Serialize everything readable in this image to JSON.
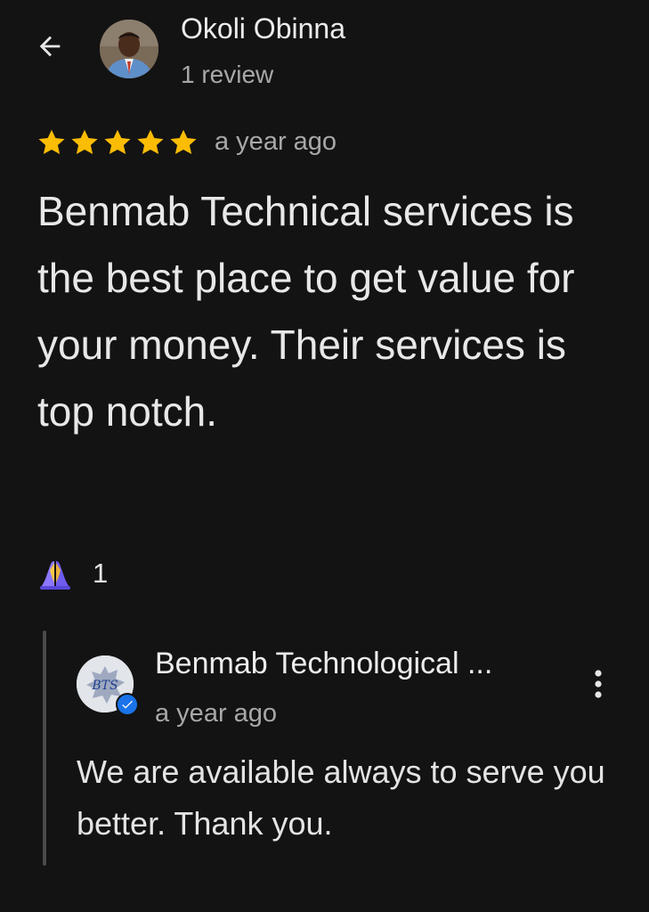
{
  "header": {
    "back_icon": "arrow-back-icon",
    "reviewer_name": "Okoli Obinna",
    "review_count": "1 review",
    "avatar_icon": "reviewer-photo"
  },
  "review": {
    "rating": 5,
    "rating_max": 5,
    "star_color": "#fbbc04",
    "time": "a year ago",
    "text": "Benmab Technical services is the best place to get value for your money. Their services is top notch."
  },
  "reaction": {
    "icon": "folded-hands-emoji",
    "count": "1"
  },
  "owner_response": {
    "name": "Benmab Technological ...",
    "time": "a year ago",
    "text": "We are available always to serve you better. Thank you.",
    "logo_text": "BTS",
    "verified_icon": "verified-check-icon",
    "verified_color": "#1a73e8",
    "more_icon": "more-vert-icon"
  }
}
